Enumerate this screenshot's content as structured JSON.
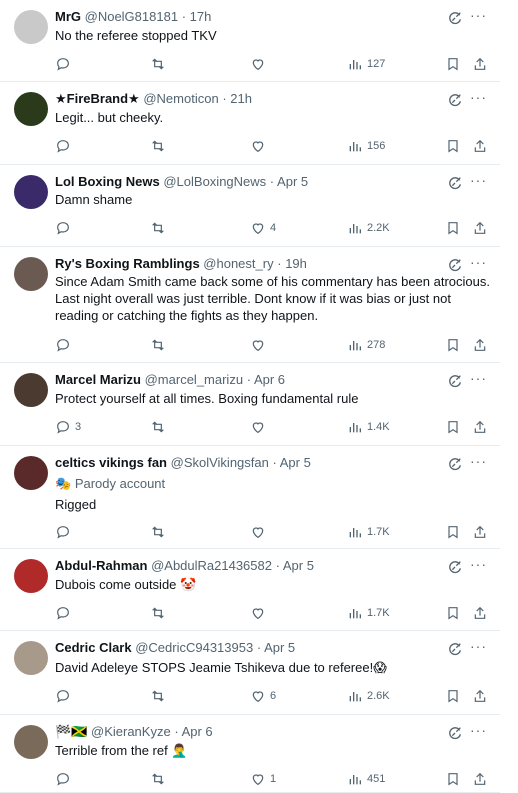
{
  "tweets": [
    {
      "name": "MrG",
      "handle": "@NoelG818181",
      "time": "17h",
      "text": "No the referee stopped TKV",
      "parody": "",
      "replies": "",
      "likes": "",
      "views": "127",
      "avatar_color": "#c9c9c9",
      "avatar_icon": "crest-avatar"
    },
    {
      "name": "★FireBrand★",
      "handle": "@Nemoticon",
      "time": "21h",
      "text": "Legit... but cheeky.",
      "parody": "",
      "replies": "",
      "likes": "",
      "views": "156",
      "avatar_color": "#2a3a1a",
      "avatar_icon": "flame-avatar"
    },
    {
      "name": "Lol Boxing News",
      "handle": "@LolBoxingNews",
      "time": "Apr 5",
      "text": "Damn shame",
      "parody": "",
      "replies": "",
      "likes": "4",
      "views": "2.2K",
      "avatar_color": "#3a2a6a",
      "avatar_icon": "lol-avatar"
    },
    {
      "name": "Ry's Boxing Ramblings",
      "handle": "@honest_ry",
      "time": "19h",
      "text": "Since Adam Smith came back some of his commentary has been atrocious. Last night overall was just terrible. Dont know if it was bias or just not reading or catching the fights as they happen.",
      "parody": "",
      "replies": "",
      "likes": "",
      "views": "278",
      "avatar_color": "#6b5a52",
      "avatar_icon": "photo-avatar"
    },
    {
      "name": "Marcel Marizu",
      "handle": "@marcel_marizu",
      "time": "Apr 6",
      "text": "Protect yourself at all times. Boxing fundamental rule",
      "parody": "",
      "replies": "3",
      "likes": "",
      "views": "1.4K",
      "avatar_color": "#4a3a30",
      "avatar_icon": "photo-avatar"
    },
    {
      "name": "celtics vikings fan",
      "handle": "@SkolVikingsfan",
      "time": "Apr 5",
      "text": "Rigged",
      "parody": "Parody account",
      "replies": "",
      "likes": "",
      "views": "1.7K",
      "avatar_color": "#5a2a2a",
      "avatar_icon": "photo-avatar"
    },
    {
      "name": "Abdul-Rahman",
      "handle": "@AbdulRa21436582",
      "time": "Apr 5",
      "text": "Dubois come outside 🤡",
      "parody": "",
      "replies": "",
      "likes": "",
      "views": "1.7K",
      "avatar_color": "#b02a2a",
      "avatar_icon": "photo-avatar"
    },
    {
      "name": "Cedric Clark",
      "handle": "@CedricC94313953",
      "time": "Apr 5",
      "text": "David Adeleye STOPS Jeamie Tshikeva due to referee!😱",
      "parody": "",
      "replies": "",
      "likes": "6",
      "views": "2.6K",
      "avatar_color": "#a89a8a",
      "avatar_icon": "photo-avatar"
    },
    {
      "name": "🏁🇯🇲",
      "handle": "@KieranKyze",
      "time": "Apr 6",
      "text": "Terrible from the ref 🤦‍♂️",
      "parody": "",
      "replies": "",
      "likes": "1",
      "views": "451",
      "avatar_color": "#7a6a5a",
      "avatar_icon": "photo-avatar"
    }
  ],
  "separator": "·"
}
